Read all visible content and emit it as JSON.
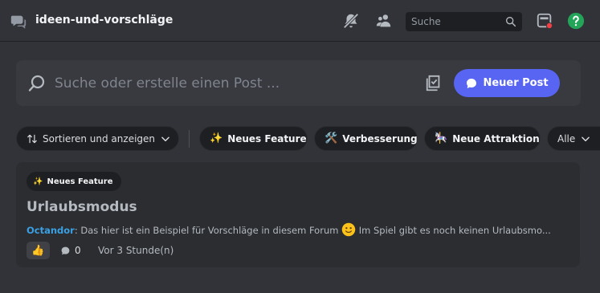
{
  "header": {
    "channel_name": "ideen-und-vorschläge",
    "search_placeholder": "Suche",
    "icons": [
      "forum-icon",
      "mute-bell-icon",
      "members-icon",
      "search-icon",
      "inbox-icon",
      "help-icon"
    ],
    "help_color": "#23a559",
    "inbox_badge_color": "#f23f43"
  },
  "post_search": {
    "placeholder": "Suche oder erstelle einen Post ...",
    "new_post_label": "Neuer Post",
    "accent": "#5865f2"
  },
  "filters": {
    "sort_label": "Sortieren und anzeigen",
    "tags": [
      {
        "emoji": "✨",
        "label": "Neues Feature"
      },
      {
        "emoji": "🛠️",
        "label": "Verbesserung"
      },
      {
        "emoji": "🎠",
        "label": "Neue Attraktion"
      }
    ],
    "all_label": "Alle"
  },
  "posts": [
    {
      "tag_emoji": "✨",
      "tag_label": "Neues Feature",
      "title": "Urlaubsmodus",
      "author": "Octandor",
      "preview_before": "Das hier ist ein Beispiel für Vorschläge in diesem Forum",
      "preview_after": "Im Spiel gibt es noch keinen Urlaubsmo...",
      "reaction_emoji": "👍",
      "reply_count": "0",
      "time_ago": "Vor 3 Stunde(n)"
    }
  ]
}
